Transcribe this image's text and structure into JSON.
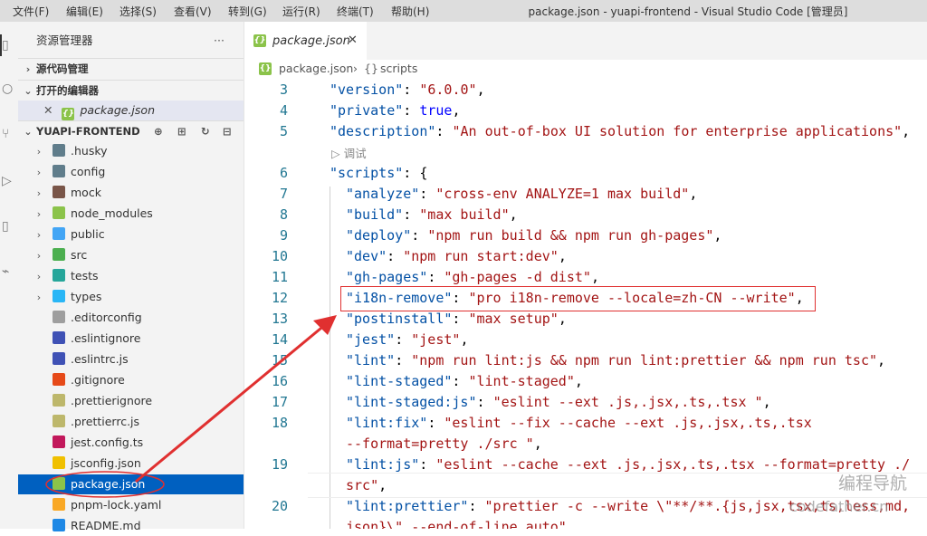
{
  "menu": [
    "文件(F)",
    "编辑(E)",
    "选择(S)",
    "查看(V)",
    "转到(G)",
    "运行(R)",
    "终端(T)",
    "帮助(H)"
  ],
  "window_title": "package.json - yuapi-frontend - Visual Studio Code [管理员]",
  "sidebar": {
    "title": "资源管理器",
    "more": "···",
    "source_control": "源代码管理",
    "open_editors": "打开的编辑器",
    "open_editor_file": "package.json",
    "project": "YUAPI-FRONTEND",
    "tree": [
      {
        "name": ".husky",
        "kind": "folder"
      },
      {
        "name": "config",
        "kind": "folder"
      },
      {
        "name": "mock",
        "kind": "folder"
      },
      {
        "name": "node_modules",
        "kind": "folder"
      },
      {
        "name": "public",
        "kind": "folder"
      },
      {
        "name": "src",
        "kind": "folder"
      },
      {
        "name": "tests",
        "kind": "folder"
      },
      {
        "name": "types",
        "kind": "folder"
      },
      {
        "name": ".editorconfig",
        "kind": "file"
      },
      {
        "name": ".eslintignore",
        "kind": "file"
      },
      {
        "name": ".eslintrc.js",
        "kind": "file"
      },
      {
        "name": ".gitignore",
        "kind": "file"
      },
      {
        "name": ".prettierignore",
        "kind": "file"
      },
      {
        "name": ".prettierrc.js",
        "kind": "file"
      },
      {
        "name": "jest.config.ts",
        "kind": "file"
      },
      {
        "name": "jsconfig.json",
        "kind": "file"
      },
      {
        "name": "package.json",
        "kind": "file",
        "selected": true
      },
      {
        "name": "pnpm-lock.yaml",
        "kind": "file"
      },
      {
        "name": "README.md",
        "kind": "file"
      }
    ]
  },
  "editor": {
    "tab": "package.json",
    "breadcrumb_file": "package.json",
    "breadcrumb_symbol": "scripts",
    "debug_hint": "调试",
    "lines": [
      {
        "n": "3",
        "key": "\"version\"",
        "val": "\"6.0.0\"",
        "tail": ","
      },
      {
        "n": "4",
        "key": "\"private\"",
        "val": "true",
        "tail": ","
      },
      {
        "n": "5",
        "key": "\"description\"",
        "val": "\"An out-of-box UI solution for enterprise applications\"",
        "tail": ","
      },
      {
        "n": "6",
        "key": "\"scripts\"",
        "val": "{",
        "tail": ""
      },
      {
        "n": "7",
        "key": "\"analyze\"",
        "val": "\"cross-env ANALYZE=1 max build\"",
        "tail": ","
      },
      {
        "n": "8",
        "key": "\"build\"",
        "val": "\"max build\"",
        "tail": ","
      },
      {
        "n": "9",
        "key": "\"deploy\"",
        "val": "\"npm run build && npm run gh-pages\"",
        "tail": ","
      },
      {
        "n": "10",
        "key": "\"dev\"",
        "val": "\"npm run start:dev\"",
        "tail": ","
      },
      {
        "n": "11",
        "key": "\"gh-pages\"",
        "val": "\"gh-pages -d dist\"",
        "tail": ","
      },
      {
        "n": "12",
        "key": "\"i18n-remove\"",
        "val": "\"pro i18n-remove --locale=zh-CN --write\"",
        "tail": ","
      },
      {
        "n": "13",
        "key": "\"postinstall\"",
        "val": "\"max setup\"",
        "tail": ","
      },
      {
        "n": "14",
        "key": "\"jest\"",
        "val": "\"jest\"",
        "tail": ","
      },
      {
        "n": "15",
        "key": "\"lint\"",
        "val": "\"npm run lint:js && npm run lint:prettier && npm run tsc\"",
        "tail": ","
      },
      {
        "n": "16",
        "key": "\"lint-staged\"",
        "val": "\"lint-staged\"",
        "tail": ","
      },
      {
        "n": "17",
        "key": "\"lint-staged:js\"",
        "val": "\"eslint --ext .js,.jsx,.ts,.tsx \"",
        "tail": ","
      },
      {
        "n": "18",
        "key": "\"lint:fix\"",
        "val": "\"eslint --fix --cache --ext .js,.jsx,.ts,.tsx",
        "tail": ""
      },
      {
        "n": "",
        "key": "",
        "val": "--format=pretty ./src \"",
        "tail": ","
      },
      {
        "n": "19",
        "key": "\"lint:js\"",
        "val": "\"eslint --cache --ext .js,.jsx,.ts,.tsx --format=pretty ./",
        "tail": ""
      },
      {
        "n": "",
        "key": "",
        "val": "src\"",
        "tail": ","
      },
      {
        "n": "20",
        "key": "\"lint:prettier\"",
        "val": "\"prettier -c --write \\\"**/**.{js,jsx,tsx,ts,less,md,",
        "tail": ""
      },
      {
        "n": "",
        "key": "",
        "val": "json}\\\" --end-of-line auto\"",
        "tail": ""
      }
    ]
  },
  "watermark": [
    "编程导航",
    "codefather.cn"
  ],
  "colors": {
    "accent": "#0060c0",
    "annotation": "#e03030"
  }
}
